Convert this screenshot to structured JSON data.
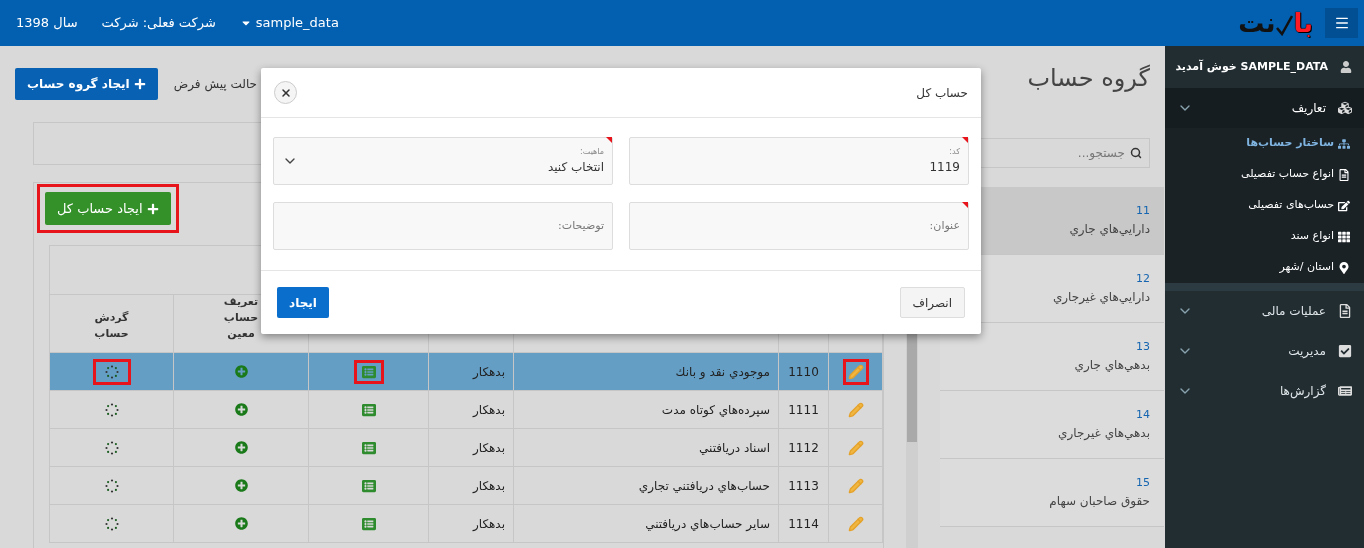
{
  "header": {
    "logo": {
      "red_part": "با",
      "black_part": "نت"
    },
    "database": "sample_data",
    "company": "شرکت فعلی: شرکت",
    "year": "سال 1398"
  },
  "sidebar": {
    "user": "SAMPLE_DATA خوش آمدید",
    "menu": [
      {
        "label": "تعاریف",
        "expanded": true,
        "children": [
          {
            "label": "ساختار حساب‌ها",
            "selected": true
          },
          {
            "label": "انواع حساب تفصیلی",
            "selected": false
          },
          {
            "label": "حساب‌های تفصیلی",
            "selected": false
          },
          {
            "label": "انواع سند",
            "selected": false
          },
          {
            "label": "استان /شهر",
            "selected": false
          }
        ]
      },
      {
        "label": "عملیات مالی",
        "expanded": false
      },
      {
        "label": "مدیریت",
        "expanded": false
      },
      {
        "label": "گزارش‌ها",
        "expanded": false
      }
    ]
  },
  "page": {
    "title": "گروه حساب",
    "create_group_button": "ایجاد گروه حساب",
    "reset_text": "حالت پیش فرض",
    "search": {
      "placeholder": "جستجو..."
    },
    "groups": [
      {
        "code": "11",
        "name": "دارايي‌هاي جاري",
        "selected": true
      },
      {
        "code": "12",
        "name": "دارايي‌هاي غيرجاري",
        "selected": false
      },
      {
        "code": "13",
        "name": "بدهي‌هاي جاري",
        "selected": false
      },
      {
        "code": "14",
        "name": "بدهي‌هاي غيرجاري",
        "selected": false
      },
      {
        "code": "15",
        "name": "حقوق صاحبان سهام",
        "selected": false
      }
    ],
    "create_account_button": {
      "label": "ایجاد حساب کل",
      "highlighted": true
    },
    "table": {
      "columns": [
        "تعریف حساب معین",
        "گردش حساب"
      ],
      "rows": [
        {
          "code": "1110",
          "title": "موجودي نقد و بانك",
          "nature": "بدهکار",
          "selected": true,
          "highlighted": true
        },
        {
          "code": "1111",
          "title": "سپرده‌هاي كوتاه مدت",
          "nature": "بدهکار",
          "selected": false,
          "highlighted": false
        },
        {
          "code": "1112",
          "title": "اسناد دريافتني",
          "nature": "بدهکار",
          "selected": false,
          "highlighted": false
        },
        {
          "code": "1113",
          "title": "حساب‌هاي دريافتني تجاري",
          "nature": "بدهکار",
          "selected": false,
          "highlighted": false
        },
        {
          "code": "1114",
          "title": "ساير حساب‌هاي دريافتني",
          "nature": "بدهکار",
          "selected": false,
          "highlighted": false
        }
      ]
    }
  },
  "modal": {
    "title": "حساب کل",
    "fields": [
      {
        "kind": "input",
        "label": "کد:",
        "value": "1119",
        "required": true
      },
      {
        "kind": "select",
        "label": "ماهیت:",
        "value": "انتخاب کنید",
        "required": true
      },
      {
        "kind": "input",
        "placeholder": "عنوان:",
        "required": true
      },
      {
        "kind": "input",
        "placeholder": "توضیحات:",
        "required": false
      }
    ],
    "cancel_button": "انصراف",
    "create_button": "ایجاد"
  }
}
